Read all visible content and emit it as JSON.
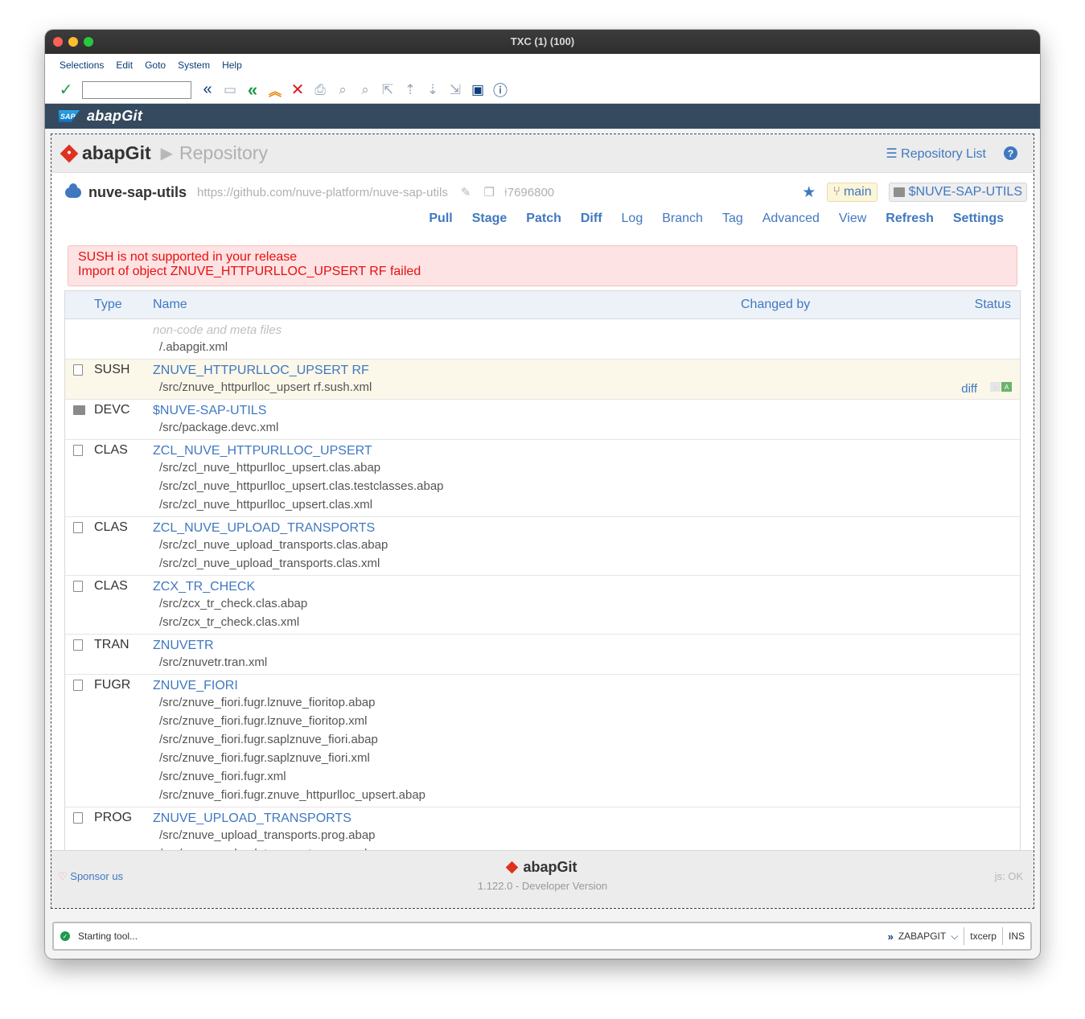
{
  "window": {
    "title": "TXC (1) (100)"
  },
  "menu": [
    "Selections",
    "Edit",
    "Goto",
    "System",
    "Help"
  ],
  "toolbar": {
    "command_value": ""
  },
  "sapbar": {
    "logo_text": "SAP",
    "title": "abapGit"
  },
  "header": {
    "brand": "abapGit",
    "page_title": "Repository",
    "repo_list_label": "Repository List",
    "help_label": "?"
  },
  "repo": {
    "name": "nuve-sap-utils",
    "url": "https://github.com/nuve-platform/nuve-sap-utils",
    "commit": "7696800",
    "branch": "main",
    "package": "$NUVE-SAP-UTILS"
  },
  "actions": [
    {
      "label": "Pull",
      "bold": true
    },
    {
      "label": "Stage",
      "bold": true
    },
    {
      "label": "Patch",
      "bold": true
    },
    {
      "label": "Diff",
      "bold": true
    },
    {
      "label": "Log",
      "bold": false
    },
    {
      "label": "Branch",
      "bold": false
    },
    {
      "label": "Tag",
      "bold": false
    },
    {
      "label": "Advanced",
      "bold": false
    },
    {
      "label": "View",
      "bold": false
    },
    {
      "label": "Refresh",
      "bold": true
    },
    {
      "label": "Settings",
      "bold": true
    }
  ],
  "errors": [
    "SUSH is not supported in your release",
    "Import of object ZNUVE_HTTPURLLOC_UPSERT RF failed"
  ],
  "table": {
    "headers": {
      "type": "Type",
      "name": "Name",
      "changed_by": "Changed by",
      "status": "Status"
    },
    "rows": [
      {
        "type": "",
        "name": "non-code and meta files",
        "meta": true,
        "icon": "",
        "files": [
          "/.abapgit.xml"
        ]
      },
      {
        "type": "SUSH",
        "name": "ZNUVE_HTTPURLLOC_UPSERT RF",
        "icon": "file",
        "highlight": true,
        "diff": "diff",
        "flag_left": "·",
        "flag_right": "A",
        "files": [
          "/src/znuve_httpurlloc_upsert rf.sush.xml"
        ]
      },
      {
        "type": "DEVC",
        "name": "$NUVE-SAP-UTILS",
        "icon": "package",
        "files": [
          "/src/package.devc.xml"
        ]
      },
      {
        "type": "CLAS",
        "name": "ZCL_NUVE_HTTPURLLOC_UPSERT",
        "icon": "code",
        "files": [
          "/src/zcl_nuve_httpurlloc_upsert.clas.abap",
          "/src/zcl_nuve_httpurlloc_upsert.clas.testclasses.abap",
          "/src/zcl_nuve_httpurlloc_upsert.clas.xml"
        ]
      },
      {
        "type": "CLAS",
        "name": "ZCL_NUVE_UPLOAD_TRANSPORTS",
        "icon": "code",
        "files": [
          "/src/zcl_nuve_upload_transports.clas.abap",
          "/src/zcl_nuve_upload_transports.clas.xml"
        ]
      },
      {
        "type": "CLAS",
        "name": "ZCX_TR_CHECK",
        "icon": "code",
        "files": [
          "/src/zcx_tr_check.clas.abap",
          "/src/zcx_tr_check.clas.xml"
        ]
      },
      {
        "type": "TRAN",
        "name": "ZNUVETR",
        "icon": "file",
        "files": [
          "/src/znuvetr.tran.xml"
        ]
      },
      {
        "type": "FUGR",
        "name": "ZNUVE_FIORI",
        "icon": "code",
        "files": [
          "/src/znuve_fiori.fugr.lznuve_fioritop.abap",
          "/src/znuve_fiori.fugr.lznuve_fioritop.xml",
          "/src/znuve_fiori.fugr.saplznuve_fiori.abap",
          "/src/znuve_fiori.fugr.saplznuve_fiori.xml",
          "/src/znuve_fiori.fugr.xml",
          "/src/znuve_fiori.fugr.znuve_httpurlloc_upsert.abap"
        ]
      },
      {
        "type": "PROG",
        "name": "ZNUVE_UPLOAD_TRANSPORTS",
        "icon": "code",
        "files": [
          "/src/znuve_upload_transports.prog.abap",
          "/src/znuve_upload_transports.prog.xml"
        ]
      }
    ]
  },
  "footer": {
    "sponsor": "Sponsor us",
    "brand": "abapGit",
    "version": "1.122.0 - Developer Version",
    "js_status": "js: OK"
  },
  "statusbar": {
    "message": "Starting tool...",
    "transaction": "ZABAPGIT",
    "server": "txcerp",
    "mode": "INS"
  }
}
